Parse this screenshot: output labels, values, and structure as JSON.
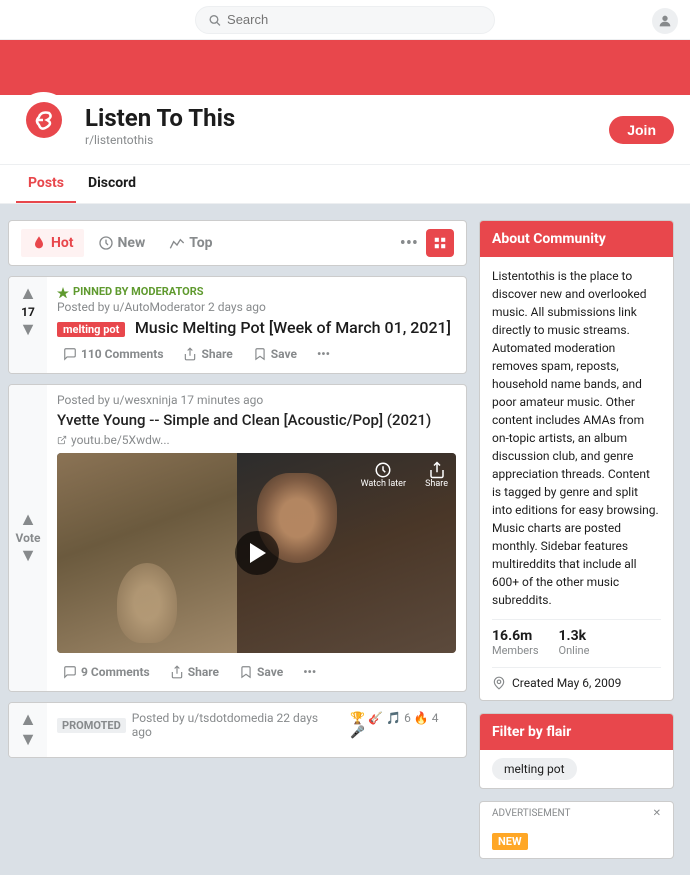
{
  "topbar": {
    "search_placeholder": "Search"
  },
  "subreddit": {
    "title": "Listen To This",
    "name": "r/listentothis",
    "join_label": "Join"
  },
  "nav": {
    "tabs": [
      {
        "id": "posts",
        "label": "Posts",
        "active": true
      },
      {
        "id": "discord",
        "label": "Discord",
        "active": false
      }
    ]
  },
  "sort": {
    "options": [
      {
        "id": "hot",
        "label": "Hot",
        "active": true
      },
      {
        "id": "new",
        "label": "New",
        "active": false
      },
      {
        "id": "top",
        "label": "Top",
        "active": false
      }
    ]
  },
  "posts": [
    {
      "id": "pinned",
      "pinned": true,
      "pinned_label": "PINNED BY MODERATORS",
      "meta": "Posted by u/AutoModerator 2 days ago",
      "flair": "melting pot",
      "title": "Music Melting Pot [Week of March 01, 2021]",
      "votes": "17",
      "actions": [
        {
          "id": "comments",
          "label": "110 Comments"
        },
        {
          "id": "share",
          "label": "Share"
        },
        {
          "id": "save",
          "label": "Save"
        }
      ]
    },
    {
      "id": "video",
      "meta": "Posted by u/wesxninja 17 minutes ago",
      "title": "Yvette Young -- Simple and Clean [Acoustic/Pop] (2021)",
      "url": "youtu.be/5Xwdw...",
      "vote_label": "Vote",
      "actions": [
        {
          "id": "comments",
          "label": "9 Comments"
        },
        {
          "id": "share",
          "label": "Share"
        },
        {
          "id": "save",
          "label": "Save"
        }
      ],
      "video_watch_later": "Watch later",
      "video_share": "Share"
    }
  ],
  "promoted": {
    "label": "PROMOTED",
    "meta": "Posted by u/tsdotdomedia 22 days ago"
  },
  "sidebar": {
    "community_header": "About Community",
    "description": "Listentothis is the place to discover new and overlooked music. All submissions link directly to music streams. Automated moderation removes spam, reposts, household name bands, and poor amateur music. Other content includes AMAs from on-topic artists, an album discussion club, and genre appreciation threads. Content is tagged by genre and split into editions for easy browsing. Music charts are posted monthly. Sidebar features multireddits that include all 600+ of the other music subreddits.",
    "members_count": "16.6m",
    "members_label": "Members",
    "online_count": "1.3k",
    "online_label": "Online",
    "created": "Created May 6, 2009",
    "filter_header": "Filter by flair",
    "flair_tag": "melting pot",
    "ad_label": "ADVERTISEMENT",
    "ad_new": "NEW"
  }
}
